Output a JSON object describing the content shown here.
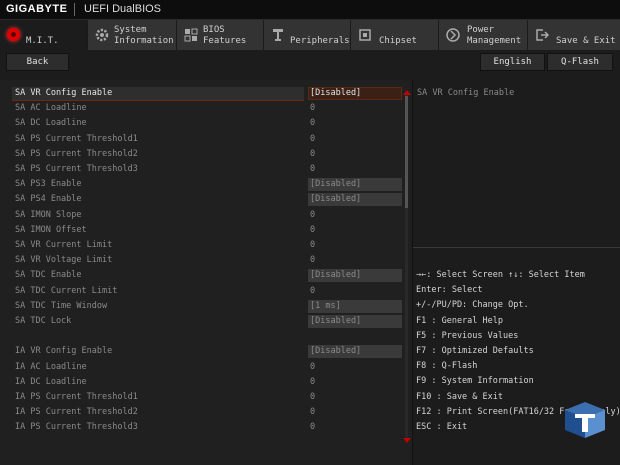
{
  "titlebar": {
    "brand": "GIGABYTE",
    "product": "UEFI DualBIOS"
  },
  "tabs": [
    {
      "label": "M.I.T.",
      "icon": "mit-icon"
    },
    {
      "label": "System\nInformation",
      "icon": "gear-icon"
    },
    {
      "label": "BIOS\nFeatures",
      "icon": "bios-icon"
    },
    {
      "label": "Peripherals",
      "icon": "peripherals-icon"
    },
    {
      "label": "Chipset",
      "icon": "chipset-icon"
    },
    {
      "label": "Power\nManagement",
      "icon": "power-icon"
    },
    {
      "label": "Save & Exit",
      "icon": "exit-icon"
    }
  ],
  "toolbar": {
    "back": "Back",
    "language": "English",
    "qflash": "Q-Flash"
  },
  "settings": [
    {
      "name": "SA VR Config Enable",
      "value": "[Disabled]",
      "boxed": true,
      "selected": true
    },
    {
      "name": "SA AC Loadline",
      "value": "0",
      "boxed": false
    },
    {
      "name": "SA DC Loadline",
      "value": "0",
      "boxed": false
    },
    {
      "name": "SA PS Current Threshold1",
      "value": "0",
      "boxed": false
    },
    {
      "name": "SA PS Current Threshold2",
      "value": "0",
      "boxed": false
    },
    {
      "name": "SA PS Current Threshold3",
      "value": "0",
      "boxed": false
    },
    {
      "name": "SA PS3 Enable",
      "value": "[Disabled]",
      "boxed": true
    },
    {
      "name": "SA PS4 Enable",
      "value": "[Disabled]",
      "boxed": true
    },
    {
      "name": "SA IMON Slope",
      "value": "0",
      "boxed": false
    },
    {
      "name": "SA IMON Offset",
      "value": "0",
      "boxed": false
    },
    {
      "name": "SA VR Current Limit",
      "value": "0",
      "boxed": false
    },
    {
      "name": "SA VR Voltage Limit",
      "value": "0",
      "boxed": false
    },
    {
      "name": "SA TDC Enable",
      "value": "[Disabled]",
      "boxed": true
    },
    {
      "name": "SA TDC Current Limit",
      "value": "0",
      "boxed": false
    },
    {
      "name": "SA TDC Time Window",
      "value": "[1 ms]",
      "boxed": true
    },
    {
      "name": "SA TDC Lock",
      "value": "[Disabled]",
      "boxed": true
    },
    {
      "name": "",
      "value": "",
      "boxed": false
    },
    {
      "name": "IA VR Config Enable",
      "value": "[Disabled]",
      "boxed": true
    },
    {
      "name": "IA AC Loadline",
      "value": "0",
      "boxed": false
    },
    {
      "name": "IA DC Loadline",
      "value": "0",
      "boxed": false
    },
    {
      "name": "IA PS Current Threshold1",
      "value": "0",
      "boxed": false
    },
    {
      "name": "IA PS Current Threshold2",
      "value": "0",
      "boxed": false
    },
    {
      "name": "IA PS Current Threshold3",
      "value": "0",
      "boxed": false
    }
  ],
  "help": {
    "title": "SA VR Config Enable"
  },
  "keys": [
    "→←: Select Screen  ↑↓: Select Item",
    "Enter: Select",
    "+/-/PU/PD: Change Opt.",
    "F1  : General Help",
    "F5  : Previous Values",
    "F7  : Optimized Defaults",
    "F8  : Q-Flash",
    "F9  : System Information",
    "F10 : Save & Exit",
    "F12 : Print Screen(FAT16/32 Format Only)",
    "ESC : Exit"
  ],
  "colors": {
    "accent": "#e00000",
    "background": "#1c1c1c",
    "tab": "#333333"
  }
}
